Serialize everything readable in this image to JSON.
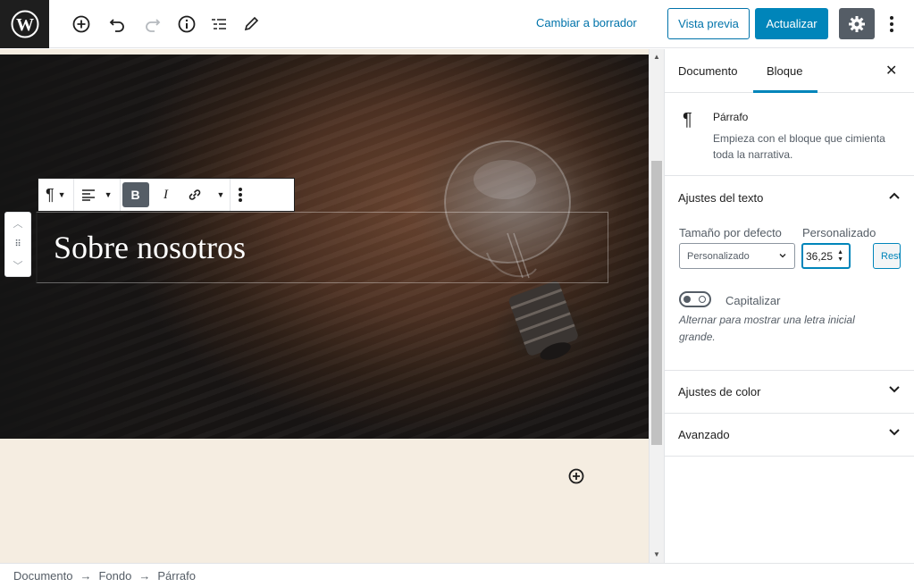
{
  "topbar": {
    "switch_draft_label": "Cambiar a borrador",
    "preview_label": "Vista previa",
    "update_label": "Actualizar",
    "accent_color": "#0085ba"
  },
  "editor": {
    "paragraph_text": "Sobre nosotros",
    "bold_label": "B",
    "italic_label": "I"
  },
  "sidebar": {
    "tabs": [
      {
        "label": "Documento"
      },
      {
        "label": "Bloque"
      }
    ],
    "active_tab": "Bloque",
    "block_card": {
      "title": "Párrafo",
      "description": "Empieza con el bloque que cimienta toda la narrativa."
    },
    "text_settings": {
      "heading": "Ajustes del texto",
      "default_size_label": "Tamaño por defecto",
      "custom_label": "Personalizado",
      "size_select_value": "Personalizado",
      "custom_size_value": "36,25",
      "reset_label": "Restablecer",
      "dropcap_label": "Capitalizar",
      "dropcap_help": "Alternar para mostrar una letra inicial grande."
    },
    "color_settings": {
      "heading": "Ajustes de color"
    },
    "advanced": {
      "heading": "Avanzado"
    }
  },
  "breadcrumb": [
    "Documento",
    "Fondo",
    "Párrafo"
  ],
  "breadcrumb_separator": "→"
}
